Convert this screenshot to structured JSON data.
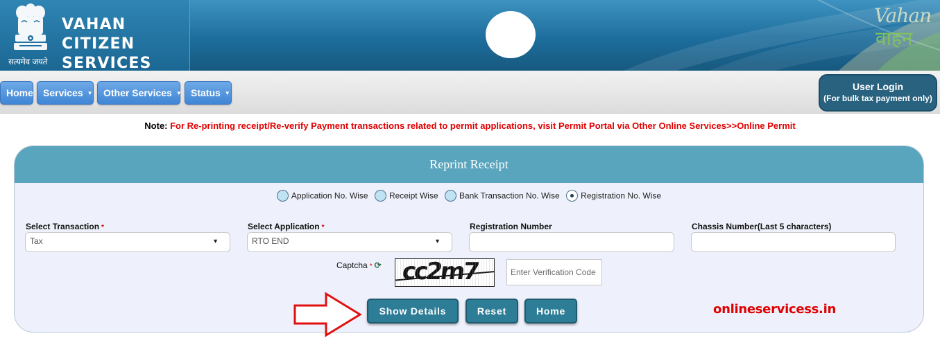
{
  "header": {
    "title_line1": "VAHAN CITIZEN",
    "title_line2": "SERVICES",
    "motto": "सत्यमेव जयते",
    "logo_text_top": "Vahan",
    "logo_text_bottom": "वाहन",
    "emblem_icon": "national-emblem-icon"
  },
  "nav": {
    "home": "Home",
    "services": "Services",
    "other_services": "Other Services",
    "status": "Status",
    "caret": "▼",
    "user_login_line1": "User Login",
    "user_login_line2": "(For bulk tax payment only)"
  },
  "note": {
    "label": "Note:",
    "text": " For Re-printing receipt/Re-verify Payment transactions related to permit applications, visit Permit Portal via Other Online Services>>Online Permit"
  },
  "panel": {
    "title": "Reprint Receipt",
    "radios": [
      {
        "label": "Application No. Wise",
        "checked": false
      },
      {
        "label": "Receipt Wise",
        "checked": false
      },
      {
        "label": "Bank Transaction No. Wise",
        "checked": false
      },
      {
        "label": "Registration No. Wise",
        "checked": true
      }
    ],
    "fields": {
      "transaction_label": "Select Transaction",
      "transaction_value": "Tax",
      "application_label": "Select Application",
      "application_value": "RTO END",
      "registration_label": "Registration Number",
      "registration_value": "",
      "chassis_label": "Chassis Number(Last 5 characters)",
      "chassis_value": "",
      "required_mark": "*",
      "dropdown_arrow": "▼"
    },
    "captcha": {
      "label": "Captcha",
      "refresh_icon": "⟳",
      "image_text": "cc2m7",
      "input_placeholder": "Enter Verification Code"
    },
    "buttons": {
      "show_details": "Show Details",
      "reset": "Reset",
      "home": "Home"
    },
    "watermark": "onlineservicess.in"
  },
  "colors": {
    "header_blue": "#1d6d9c",
    "nav_button_blue": "#3f86d6",
    "panel_head": "#5aa5be",
    "action_button": "#2e7d96",
    "note_red": "#e10000",
    "arrow_red": "#e01010"
  }
}
